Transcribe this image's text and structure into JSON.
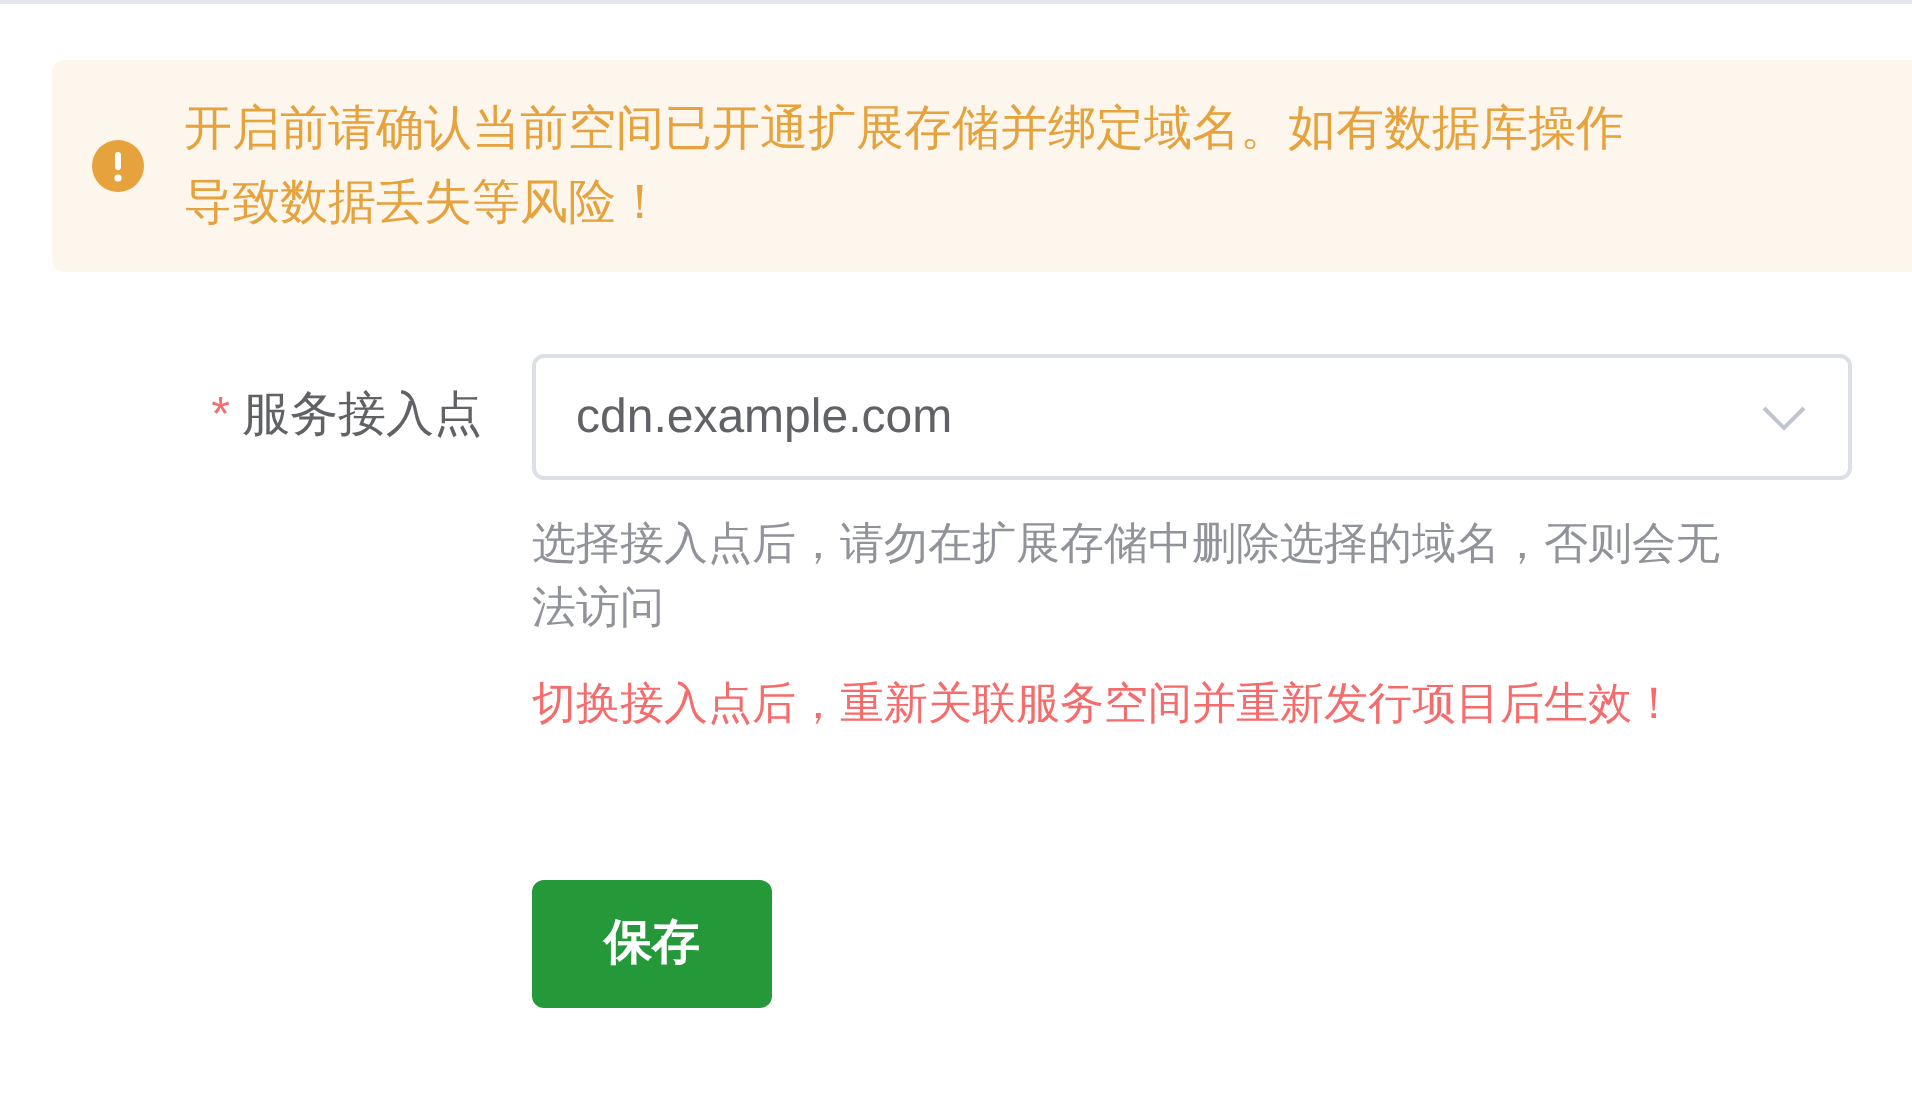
{
  "alert": {
    "lines": [
      "开启前请确认当前空间已开通扩展存储并绑定域名。如有数据库操作",
      "导致数据丢失等风险！"
    ]
  },
  "form": {
    "field": {
      "required_mark": "*",
      "label": "服务接入点",
      "value": "cdn.example.com",
      "help": "选择接入点后，请勿在扩展存储中删除选择的域名，否则会无法访问",
      "warning": "切换接入点后，重新关联服务空间并重新发行项目后生效！"
    }
  },
  "buttons": [
    {
      "label": "保存",
      "kind": "primary"
    }
  ]
}
